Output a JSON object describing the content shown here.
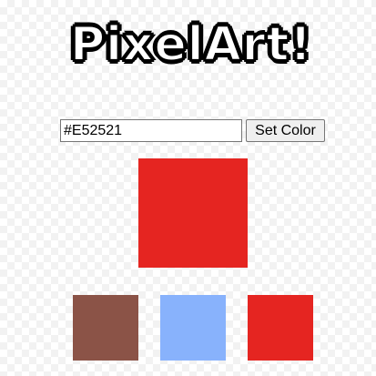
{
  "header": {
    "title": "PixelArt!"
  },
  "color_picker": {
    "input_value": "#E52521",
    "set_color_label": "Set Color"
  },
  "preview": {
    "color": "#E52521"
  },
  "swatches": [
    {
      "color": "#8B5347"
    },
    {
      "color": "#88B2FC"
    },
    {
      "color": "#E52521"
    }
  ]
}
